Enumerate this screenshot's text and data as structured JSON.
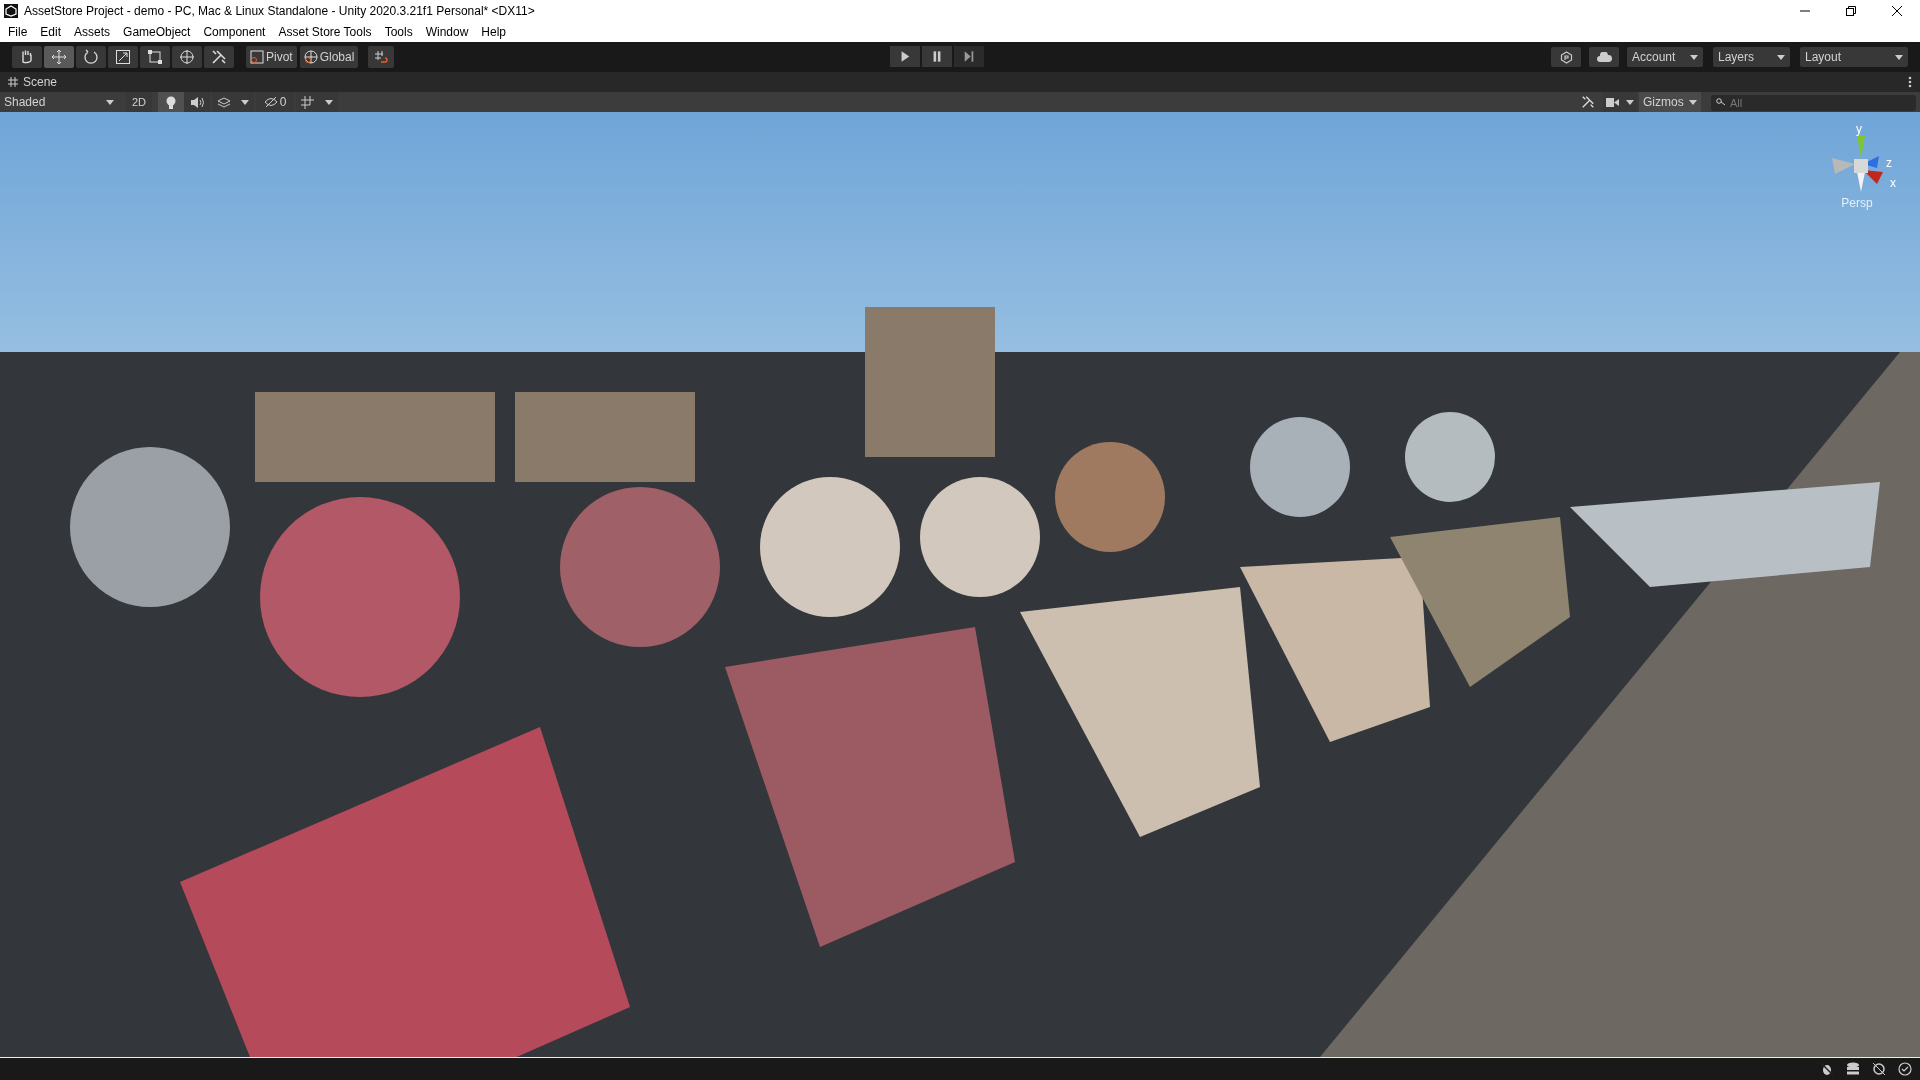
{
  "window": {
    "title": "AssetStore Project - demo - PC, Mac & Linux Standalone - Unity 2020.3.21f1 Personal* <DX11>"
  },
  "menu": [
    "File",
    "Edit",
    "Assets",
    "GameObject",
    "Component",
    "Asset Store Tools",
    "Tools",
    "Window",
    "Help"
  ],
  "tools": [
    {
      "kind": "hand",
      "selected": false
    },
    {
      "kind": "move",
      "selected": true
    },
    {
      "kind": "rotate",
      "selected": false
    },
    {
      "kind": "scale",
      "selected": false
    },
    {
      "kind": "rect",
      "selected": false
    },
    {
      "kind": "transform",
      "selected": false
    },
    {
      "kind": "custom",
      "selected": false
    }
  ],
  "handle_toggles": [
    {
      "label": "Pivot",
      "kind": "pivot"
    },
    {
      "label": "Global",
      "kind": "global"
    }
  ],
  "playback": [
    {
      "kind": "play",
      "selected": false
    },
    {
      "kind": "pause",
      "selected": false
    },
    {
      "kind": "step",
      "selected": false
    }
  ],
  "top_right": [
    "Account",
    "Layers",
    "Layout"
  ],
  "scene_tab": {
    "label": "Scene"
  },
  "scene_toolbar": {
    "draw_mode": "Shaded",
    "mode_2d": {
      "label": "2D",
      "on": false
    },
    "lighting": {
      "on": true
    },
    "audio": {
      "on": false
    },
    "hidden_count": "0",
    "search": {
      "placeholder": "All"
    },
    "gizmos": "Gizmos"
  },
  "gizmo": {
    "axes": [
      "y",
      "z",
      "x"
    ],
    "projection": "Persp"
  }
}
